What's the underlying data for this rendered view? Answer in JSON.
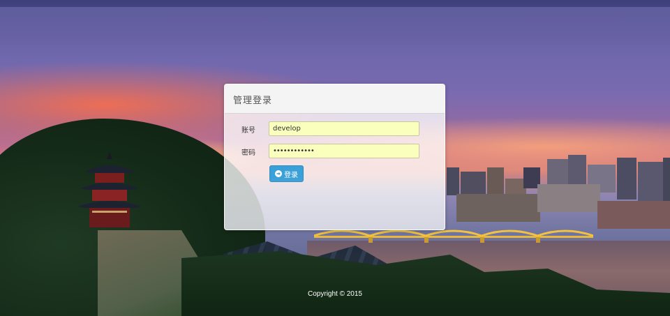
{
  "panel": {
    "title": "管理登录"
  },
  "form": {
    "username_label": "账号",
    "username_value": "develop",
    "password_label": "密码",
    "password_value": "••••••••••••",
    "login_label": "登录"
  },
  "footer": {
    "copyright": "Copyright © 2015"
  },
  "colors": {
    "button": "#3aa0d8",
    "autofill": "#faffbd"
  },
  "icons": {
    "login_icon": "circle-arrow-right-icon"
  }
}
